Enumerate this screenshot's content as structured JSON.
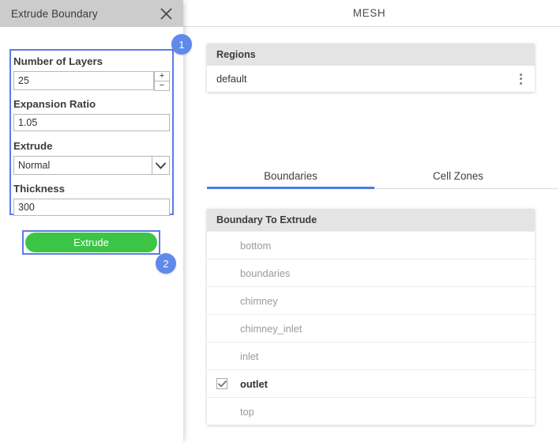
{
  "panel": {
    "title": "Extrude Boundary",
    "close_icon": "close-icon",
    "fields": {
      "layers": {
        "label": "Number of Layers",
        "value": "25",
        "increment_label": "+",
        "decrement_label": "−"
      },
      "expansion": {
        "label": "Expansion Ratio",
        "value": "1.05"
      },
      "extrude_mode": {
        "label": "Extrude",
        "value": "Normal",
        "options": [
          "Normal"
        ],
        "arrow_icon": "chevron-down-icon"
      },
      "thickness": {
        "label": "Thickness",
        "value": "300"
      }
    },
    "action": {
      "extrude_label": "Extrude",
      "button_color": "#3cc446"
    },
    "highlight_color": "#5b7ce8",
    "titlebar_color": "#cccccc"
  },
  "steps": [
    {
      "number": "1"
    },
    {
      "number": "2"
    }
  ],
  "main": {
    "header_title": "MESH",
    "regions": {
      "card_title": "Regions",
      "rows": [
        {
          "name": "default",
          "menu_icon": "kebab-menu-icon"
        }
      ]
    },
    "tabs": [
      {
        "label": "Boundaries",
        "active": true
      },
      {
        "label": "Cell Zones",
        "active": false
      }
    ],
    "tab_accent": "#4a7ce8",
    "boundaries": {
      "card_title": "Boundary To Extrude",
      "rows": [
        {
          "name": "bottom",
          "checked": false
        },
        {
          "name": "boundaries",
          "checked": false
        },
        {
          "name": "chimney",
          "checked": false
        },
        {
          "name": "chimney_inlet",
          "checked": false
        },
        {
          "name": "inlet",
          "checked": false
        },
        {
          "name": "outlet",
          "checked": true
        },
        {
          "name": "top",
          "checked": false
        }
      ],
      "check_glyph": "✔"
    }
  }
}
